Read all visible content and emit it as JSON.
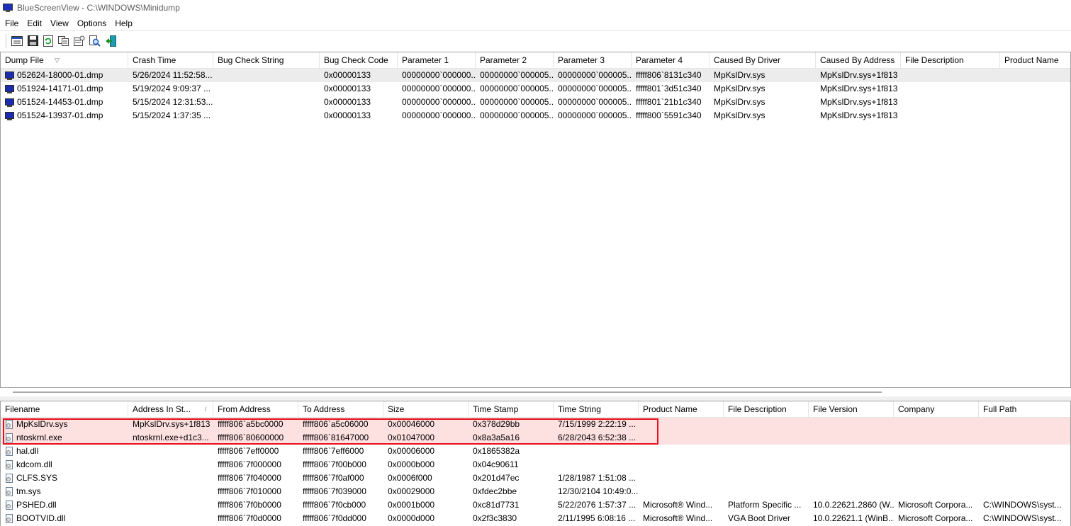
{
  "window": {
    "app_name": "BlueScreenView",
    "title": "BlueScreenView  -  C:\\WINDOWS\\Minidump"
  },
  "menu": [
    "File",
    "Edit",
    "View",
    "Options",
    "Help"
  ],
  "toolbar": {
    "buttons": [
      "html-report-icon",
      "save-icon",
      "refresh-icon",
      "copy-icon",
      "properties-icon",
      "find-icon",
      "exit-icon"
    ]
  },
  "dumps": {
    "columns": [
      "Dump File",
      "Crash Time",
      "Bug Check String",
      "Bug Check Code",
      "Parameter 1",
      "Parameter 2",
      "Parameter 3",
      "Parameter 4",
      "Caused By Driver",
      "Caused By Address",
      "File Description",
      "Product Name"
    ],
    "rows": [
      [
        "052624-18000-01.dmp",
        "5/26/2024 11:52:58...",
        "",
        "0x00000133",
        "00000000`000000...",
        "00000000`000005...",
        "00000000`000005...",
        "fffff806`8131c340",
        "MpKslDrv.sys",
        "MpKslDrv.sys+1f813",
        "",
        ""
      ],
      [
        "051924-14171-01.dmp",
        "5/19/2024 9:09:37 ...",
        "",
        "0x00000133",
        "00000000`000000...",
        "00000000`000005...",
        "00000000`000005...",
        "fffff801`3d51c340",
        "MpKslDrv.sys",
        "MpKslDrv.sys+1f813",
        "",
        ""
      ],
      [
        "051524-14453-01.dmp",
        "5/15/2024 12:31:53...",
        "",
        "0x00000133",
        "00000000`000000...",
        "00000000`000005...",
        "00000000`000005...",
        "fffff801`21b1c340",
        "MpKslDrv.sys",
        "MpKslDrv.sys+1f813",
        "",
        ""
      ],
      [
        "051524-13937-01.dmp",
        "5/15/2024 1:37:35 ...",
        "",
        "0x00000133",
        "00000000`000000...",
        "00000000`000005...",
        "00000000`000005...",
        "fffff800`5591c340",
        "MpKslDrv.sys",
        "MpKslDrv.sys+1f813",
        "",
        ""
      ]
    ]
  },
  "modules": {
    "columns": [
      "Filename",
      "Address In St...",
      "From Address",
      "To Address",
      "Size",
      "Time Stamp",
      "Time String",
      "Product Name",
      "File Description",
      "File Version",
      "Company",
      "Full Path"
    ],
    "rows": [
      [
        "MpKslDrv.sys",
        "MpKslDrv.sys+1f813",
        "fffff806`a5bc0000",
        "fffff806`a5c06000",
        "0x00046000",
        "0x378d29bb",
        "7/15/1999 2:22:19 ...",
        "",
        "",
        "",
        "",
        ""
      ],
      [
        "ntoskrnl.exe",
        "ntoskrnl.exe+d1c3...",
        "fffff806`80600000",
        "fffff806`81647000",
        "0x01047000",
        "0x8a3a5a16",
        "6/28/2043 6:52:38 ...",
        "",
        "",
        "",
        "",
        ""
      ],
      [
        "hal.dll",
        "",
        "fffff806`7eff0000",
        "fffff806`7eff6000",
        "0x00006000",
        "0x1865382a",
        "",
        "",
        "",
        "",
        "",
        ""
      ],
      [
        "kdcom.dll",
        "",
        "fffff806`7f000000",
        "fffff806`7f00b000",
        "0x0000b000",
        "0x04c90611",
        "",
        "",
        "",
        "",
        "",
        ""
      ],
      [
        "CLFS.SYS",
        "",
        "fffff806`7f040000",
        "fffff806`7f0af000",
        "0x0006f000",
        "0x201d47ec",
        "1/28/1987 1:51:08 ...",
        "",
        "",
        "",
        "",
        ""
      ],
      [
        "tm.sys",
        "",
        "fffff806`7f010000",
        "fffff806`7f039000",
        "0x00029000",
        "0xfdec2bbe",
        "12/30/2104 10:49:0...",
        "",
        "",
        "",
        "",
        ""
      ],
      [
        "PSHED.dll",
        "",
        "fffff806`7f0b0000",
        "fffff806`7f0cb000",
        "0x0001b000",
        "0xc81d7731",
        "5/22/2076 1:57:37 ...",
        "Microsoft® Wind...",
        "Platform Specific ...",
        "10.0.22621.2860 (W...",
        "Microsoft Corpora...",
        "C:\\WINDOWS\\syst..."
      ],
      [
        "BOOTVID.dll",
        "",
        "fffff806`7f0d0000",
        "fffff806`7f0dd000",
        "0x0000d000",
        "0x2f3c3830",
        "2/11/1995 6:08:16 ...",
        "Microsoft® Wind...",
        "VGA Boot Driver",
        "10.0.22621.1 (WinB...",
        "Microsoft Corpora...",
        "C:\\WINDOWS\\syst..."
      ]
    ]
  },
  "colors": {
    "selected_row": "#ececec",
    "highlight_rows": "#fde0e0",
    "annotation_box": "#e8101c"
  }
}
